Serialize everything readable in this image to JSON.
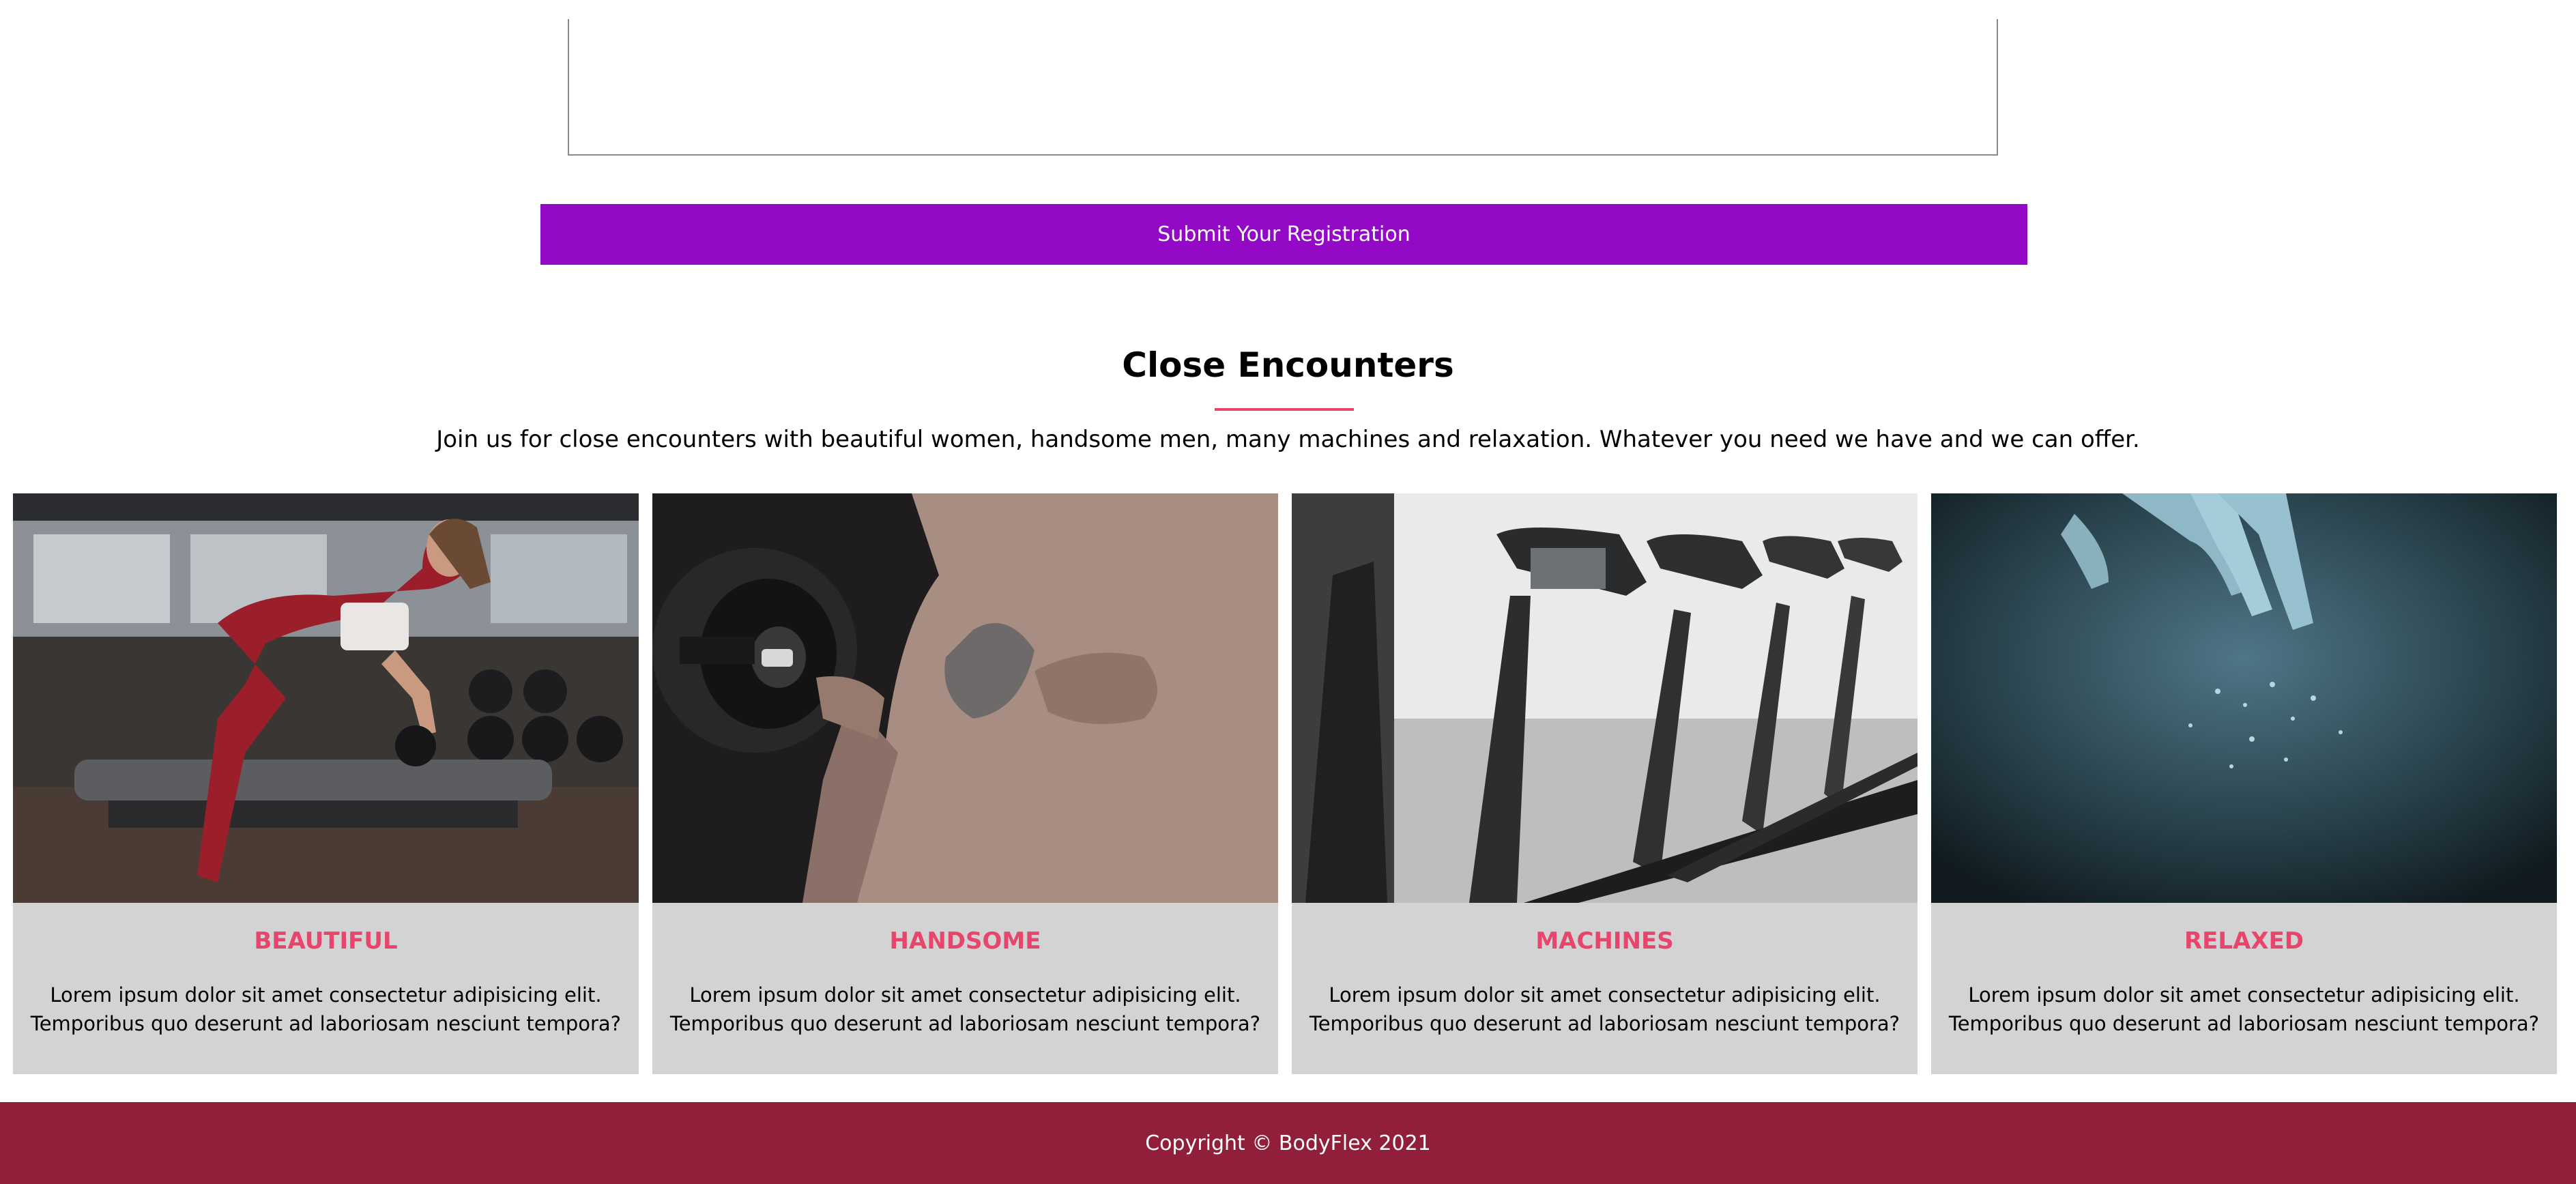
{
  "form": {
    "message_value": "",
    "submit_label": "Submit Your Registration"
  },
  "section": {
    "title": "Close Encounters",
    "subtitle": "Join us for close encounters with beautiful women, handsome men, many machines and relaxation. Whatever you need we have and we can offer."
  },
  "cards": [
    {
      "heading": "BEAUTIFUL",
      "text": "Lorem ipsum dolor sit amet consectetur adipisicing elit. Temporibus quo deserunt ad laboriosam nesciunt tempora?",
      "image": "woman-dumbbell-row-photo"
    },
    {
      "heading": "HANDSOME",
      "text": "Lorem ipsum dolor sit amet consectetur adipisicing elit. Temporibus quo deserunt ad laboriosam nesciunt tempora?",
      "image": "man-bicep-curl-photo"
    },
    {
      "heading": "MACHINES",
      "text": "Lorem ipsum dolor sit amet consectetur adipisicing elit. Temporibus quo deserunt ad laboriosam nesciunt tempora?",
      "image": "treadmills-row-photo"
    },
    {
      "heading": "RELAXED",
      "text": "Lorem ipsum dolor sit amet consectetur adipisicing elit. Temporibus quo deserunt ad laboriosam nesciunt tempora?",
      "image": "hand-on-wet-skin-photo"
    }
  ],
  "footer": {
    "copyright": "Copyright © BodyFlex 2021"
  },
  "colors": {
    "accent": "#e8456d",
    "button": "#9309c6",
    "card_bg": "#d3d3d3",
    "footer_bg": "#921f3a"
  }
}
